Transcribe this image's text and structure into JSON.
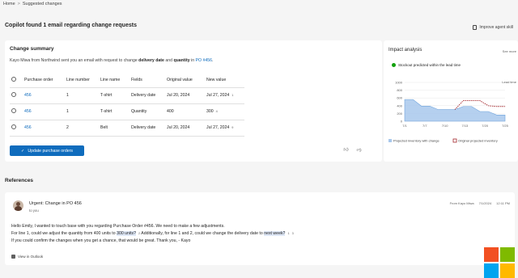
{
  "breadcrumb": {
    "home": "Home",
    "separator": ">",
    "current": "Suggested changes"
  },
  "header": {
    "title": "Copilot found 1 email regarding change requests",
    "improve_label": "Improve agent skill"
  },
  "change_summary": {
    "title": "Change summary",
    "desc_pre": "Kayo Miwa from Northwind sent you an email with request to change ",
    "desc_b1": "delivery date",
    "desc_mid": " and ",
    "desc_b2": "quantity",
    "desc_in": " in ",
    "desc_po": "PO #456",
    "desc_end": ".",
    "columns": [
      "Purchase order",
      "Line number",
      "Line name",
      "Fields",
      "Original value",
      "New value"
    ],
    "rows": [
      {
        "po": "456",
        "line": "1",
        "name": "T-shirt",
        "field": "Delivery date",
        "orig": "Jul 20, 2024",
        "new": "Jul 27, 2024",
        "ref": "1"
      },
      {
        "po": "456",
        "line": "1",
        "name": "T-shirt",
        "field": "Quantity",
        "orig": "400",
        "new": "300",
        "ref": "4"
      },
      {
        "po": "456",
        "line": "2",
        "name": "Belt",
        "field": "Delivery date",
        "orig": "Jul 20, 2024",
        "new": "Jul 27, 2024",
        "ref": "9"
      }
    ],
    "update_button": "Update purchase orders"
  },
  "impact": {
    "title": "Impact analysis",
    "see_more": "See more",
    "status": "Stockout predicted within the lead time",
    "status_color": "#13a10e"
  },
  "chart_data": {
    "type": "area",
    "ylim": [
      0,
      1000
    ],
    "y_ticks": [
      "1000",
      "800",
      "600",
      "400",
      "200",
      "0"
    ],
    "x_ticks": [
      "7/1",
      "7/7",
      "7/10",
      "7/13",
      "7/20",
      "7/25"
    ],
    "threshold_label": "Lead time",
    "series": [
      {
        "name": "Projected inventory with change",
        "color": "#a8c8ec",
        "x": [
          0,
          1,
          2,
          3,
          4,
          5,
          6,
          7,
          8,
          9,
          10,
          11,
          12
        ],
        "values": [
          560,
          560,
          390,
          390,
          300,
          300,
          300,
          380,
          380,
          250,
          250,
          160,
          160
        ]
      },
      {
        "name": "Original projected inventory",
        "color": "#a4262c",
        "x": [
          6,
          7,
          8,
          9,
          10,
          11,
          12
        ],
        "values": [
          300,
          530,
          530,
          530,
          400,
          380,
          380
        ]
      }
    ]
  },
  "references": {
    "title": "References",
    "subject": "Urgent: Change in PO 456",
    "to": "to you",
    "from": "From Kayo Miwa",
    "date": "7/1/2024",
    "time": "12:11 PM",
    "line1": "Hello Emily, I wanted to touch base with you regarding Purchase Order #456. We need to make a few adjustments.",
    "line2_a": "For line 1, could we adjust the quantity from 400 units to ",
    "line2_h1": "300 units?",
    "line2_r1": "2",
    "line2_b": "Additionally, for line 1 and 2, could we change the delivery date to ",
    "line2_h2": "next week?",
    "line2_r2": "1",
    "line2_r3": "3",
    "line3": "If you could confirm the changes when you get a chance, that would be great. Thank you, - Kayo",
    "view_outlook": "View in Outlook"
  },
  "ms_logo": {
    "colors": [
      "#f25022",
      "#7fba00",
      "#00a4ef",
      "#ffb900"
    ]
  }
}
